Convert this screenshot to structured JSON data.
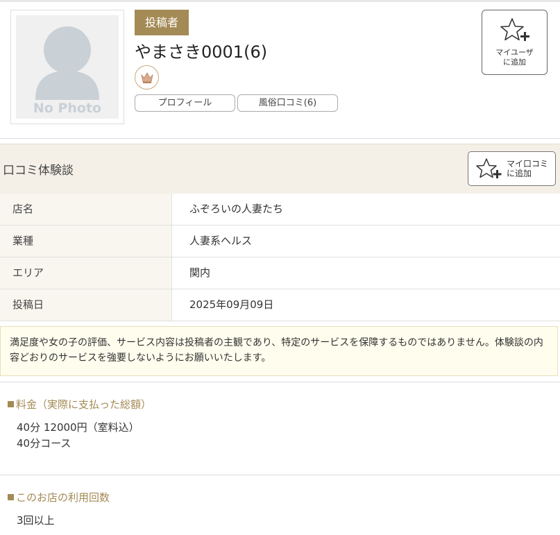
{
  "header": {
    "avatar_text": "No Photo",
    "role_badge": "投稿者",
    "username": "やまさき0001(6)",
    "profile_button": "プロフィール",
    "reviews_button": "風俗口コミ(6)",
    "myuser_button": [
      "マイユーザ",
      "に追加"
    ]
  },
  "review_section": {
    "title": "口コミ体験談",
    "mykuchi_button": [
      "マイ口コミ",
      "に追加"
    ],
    "rows": [
      {
        "label": "店名",
        "value": "ふぞろいの人妻たち"
      },
      {
        "label": "業種",
        "value": "人妻系ヘルス"
      },
      {
        "label": "エリア",
        "value": "関内"
      },
      {
        "label": "投稿日",
        "value": "2025年09月09日"
      }
    ],
    "notice": "満足度や女の子の評価、サービス内容は投稿者の主観であり、特定のサービスを保障するものではありません。体験談の内容どおりのサービスを強要しないようにお願いいたします。"
  },
  "price": {
    "heading": "料金（実際に支払った総額）",
    "lines": [
      "40分 12000円（室料込）",
      "40分コース"
    ]
  },
  "visits": {
    "heading": "このお店の利用回数",
    "value": "3回以上"
  },
  "colors": {
    "accent": "#a48a55",
    "section_bg": "#f4f0e7",
    "notice_bg": "#fffdee"
  },
  "icons": [
    "no-photo-avatar",
    "crown-icon",
    "star-plus-icon"
  ]
}
